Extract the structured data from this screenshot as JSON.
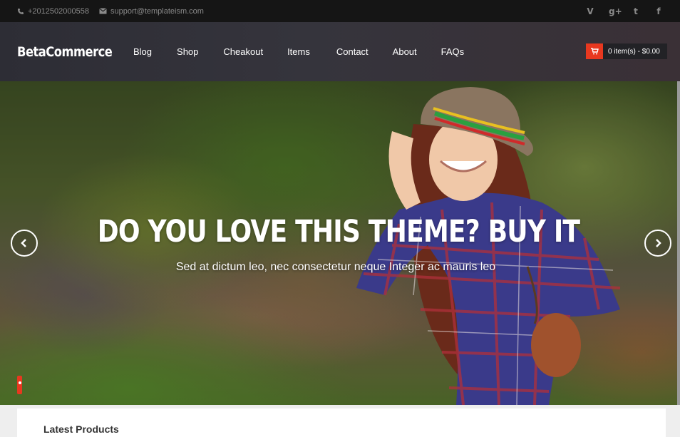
{
  "topbar": {
    "phone": "+2012502000558",
    "email": "support@templateism.com",
    "social": [
      {
        "icon": "vine-icon",
        "glyph": "V"
      },
      {
        "icon": "google-plus-icon",
        "glyph": "g+"
      },
      {
        "icon": "twitter-icon",
        "glyph": "t"
      },
      {
        "icon": "facebook-icon",
        "glyph": "f"
      }
    ]
  },
  "brand": "BetaCommerce",
  "nav": [
    "Blog",
    "Shop",
    "Cheakout",
    "Items",
    "Contact",
    "About",
    "FAQs"
  ],
  "cart": {
    "label": "0 item(s) - $0.00",
    "icon": "cart-icon",
    "accent": "#e8381f"
  },
  "hero": {
    "title": "DO YOU LOVE THIS THEME? BUY IT",
    "subtitle": "Sed at dictum leo, nec consectetur neque Integer ac mauris leo"
  },
  "section": {
    "title": "Latest Products"
  }
}
